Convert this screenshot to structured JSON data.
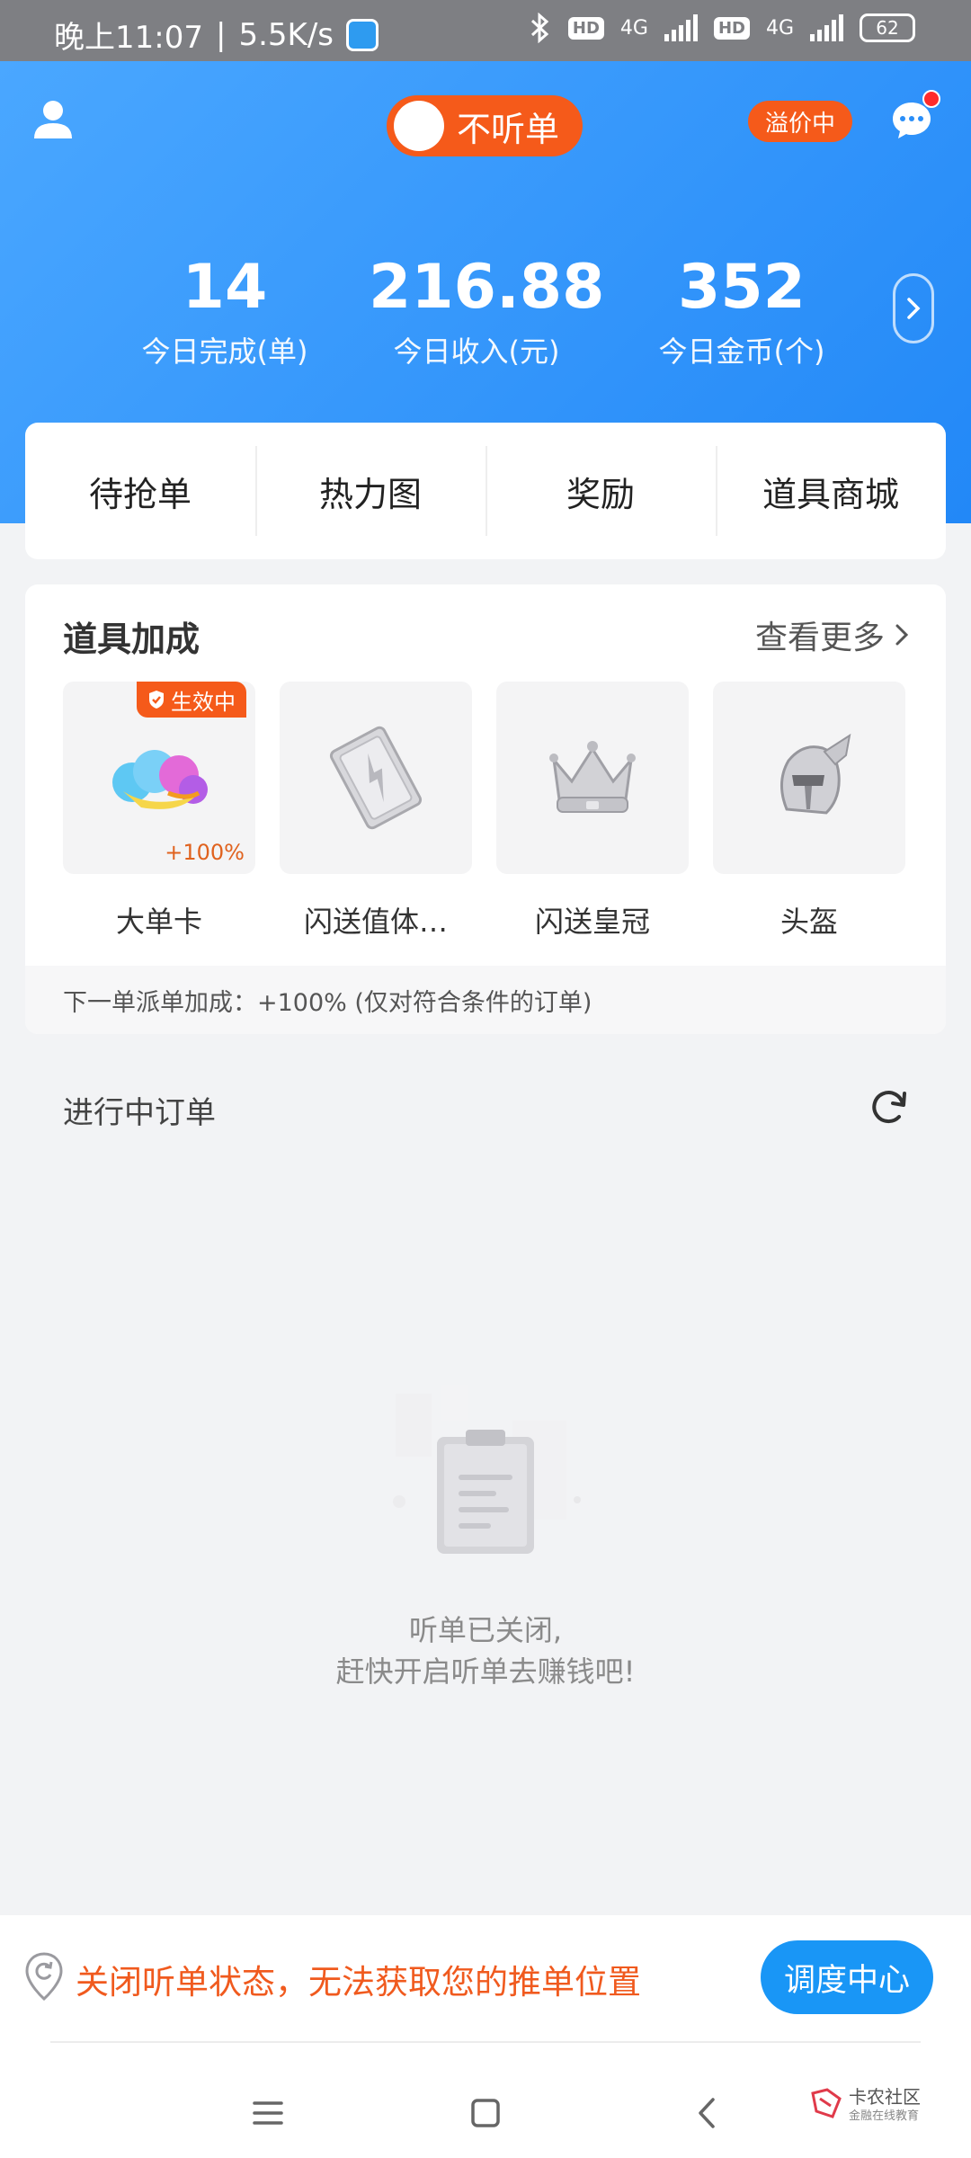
{
  "status_bar": {
    "time": "晚上11:07",
    "net_speed": "5.5K/s",
    "network_1": "4G",
    "network_2": "4G",
    "hd_label": "HD",
    "battery": "62"
  },
  "header": {
    "toggle_label": "不听单",
    "premium_badge": "溢价中",
    "stats": [
      {
        "value": "14",
        "caption": "今日完成(单)"
      },
      {
        "value": "216.88",
        "caption": "今日收入(元)"
      },
      {
        "value": "352",
        "caption": "今日金币(个)"
      }
    ]
  },
  "tabs": [
    "待抢单",
    "热力图",
    "奖励",
    "道具商城"
  ],
  "props": {
    "title": "道具加成",
    "more_label": "查看更多",
    "items": [
      {
        "name": "大单卡",
        "badge": "生效中",
        "bonus": "+100%"
      },
      {
        "name": "闪送值体…"
      },
      {
        "name": "闪送皇冠"
      },
      {
        "name": "头盔"
      }
    ],
    "footer": "下一单派单加成：+100% (仅对符合条件的订单)"
  },
  "orders": {
    "title": "进行中订单",
    "empty_line1": "听单已关闭,",
    "empty_line2": "赶快开启听单去赚钱吧!"
  },
  "bottom": {
    "location_notice": "关闭听单状态，无法获取您的推单位置",
    "dispatch_button": "调度中心"
  },
  "watermark": {
    "line1": "卡农社区",
    "line2": "金融在线教育"
  },
  "colors": {
    "primary_blue": "#2288f7",
    "accent_orange": "#f55a1a",
    "button_blue": "#1996f6"
  }
}
